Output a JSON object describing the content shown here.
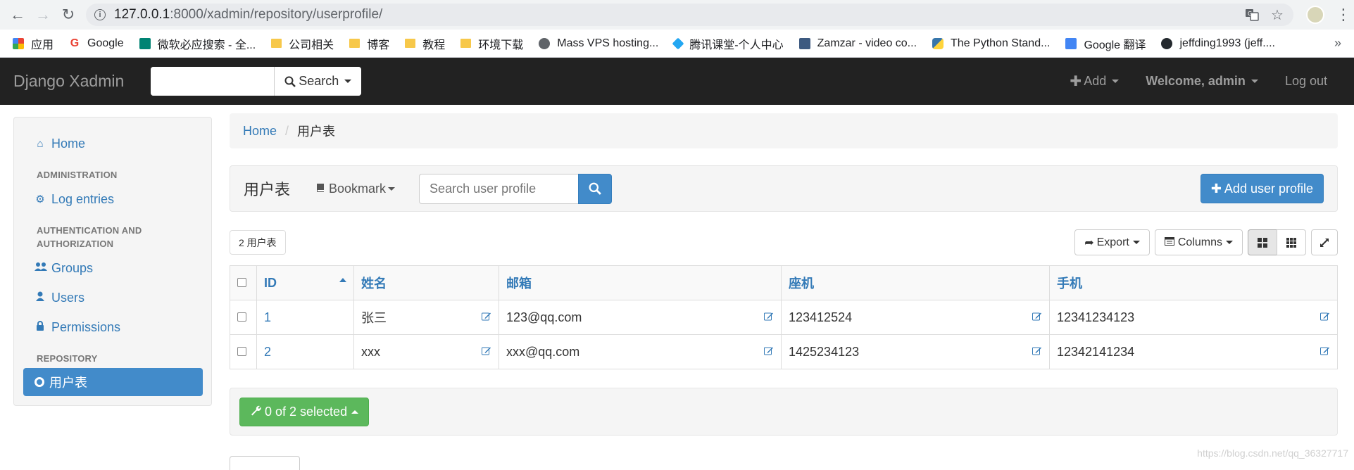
{
  "browser": {
    "url_host": "127.0.0.1",
    "url_path": ":8000/xadmin/repository/userprofile/",
    "bookmarks": [
      {
        "label": "应用",
        "icon": "apps-grid-icon",
        "color": "#4285f4"
      },
      {
        "label": "Google",
        "icon": "google-icon",
        "color": "#ea4335"
      },
      {
        "label": "微软必应搜索 - 全...",
        "icon": "bing-icon",
        "color": "#008373"
      },
      {
        "label": "公司相关",
        "icon": "folder-icon",
        "color": "#f7c84a"
      },
      {
        "label": "博客",
        "icon": "folder-icon",
        "color": "#f7c84a"
      },
      {
        "label": "教程",
        "icon": "folder-icon",
        "color": "#f7c84a"
      },
      {
        "label": "环境下载",
        "icon": "folder-icon",
        "color": "#f7c84a"
      },
      {
        "label": "Mass VPS hosting...",
        "icon": "globe-icon",
        "color": "#5f6368"
      },
      {
        "label": "腾讯课堂-个人中心",
        "icon": "tencent-icon",
        "color": "#23a7f2"
      },
      {
        "label": "Zamzar - video co...",
        "icon": "zamzar-icon",
        "color": "#3d5a80"
      },
      {
        "label": "The Python Stand...",
        "icon": "python-icon",
        "color": "#3776ab"
      },
      {
        "label": "Google 翻译",
        "icon": "translate-icon",
        "color": "#4285f4"
      },
      {
        "label": "jeffding1993 (jeff....",
        "icon": "github-icon",
        "color": "#24292e"
      }
    ],
    "more": "»"
  },
  "navbar": {
    "brand": "Django Xadmin",
    "search_label": "Search",
    "add_label": "Add",
    "welcome": "Welcome, admin",
    "logout": "Log out"
  },
  "sidebar": {
    "home": "Home",
    "sections": [
      {
        "heading": "ADMINISTRATION",
        "items": [
          {
            "label": "Log entries",
            "icon": "gear-icon"
          }
        ]
      },
      {
        "heading": "AUTHENTICATION AND AUTHORIZATION",
        "items": [
          {
            "label": "Groups",
            "icon": "users-icon"
          },
          {
            "label": "Users",
            "icon": "user-icon"
          },
          {
            "label": "Permissions",
            "icon": "lock-icon"
          }
        ]
      },
      {
        "heading": "REPOSITORY",
        "items": [
          {
            "label": "用户表",
            "icon": "circle-icon",
            "active": true
          }
        ]
      }
    ]
  },
  "breadcrumb": {
    "home": "Home",
    "current": "用户表"
  },
  "toolbar": {
    "title": "用户表",
    "bookmark": "Bookmark",
    "search_placeholder": "Search user profile",
    "add_button": "Add user profile"
  },
  "controls": {
    "count": "2 用户表",
    "export": "Export",
    "columns": "Columns"
  },
  "table": {
    "headers": [
      "ID",
      "姓名",
      "邮箱",
      "座机",
      "手机"
    ],
    "rows": [
      [
        "1",
        "张三",
        "123@qq.com",
        "123412524",
        "12341234123"
      ],
      [
        "2",
        "xxx",
        "xxx@qq.com",
        "1425234123",
        "12342141234"
      ]
    ]
  },
  "actions": {
    "selected": "0 of 2 selected"
  },
  "watermark": "https://blog.csdn.net/qq_36327717",
  "colors": {
    "primary": "#428bca",
    "success": "#5cb85c",
    "navbar": "#222222",
    "link": "#337ab7"
  }
}
